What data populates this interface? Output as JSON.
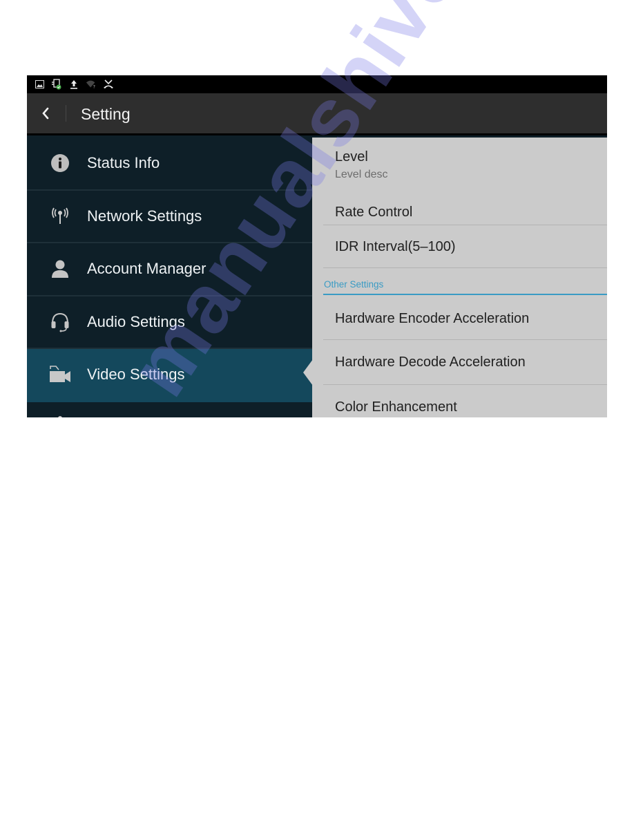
{
  "status_bar": {
    "icons": [
      "image-icon",
      "sim-card-check-icon",
      "upload-icon",
      "wifi-unknown-icon",
      "missed-call-icon"
    ]
  },
  "header": {
    "back_icon": "chevron-left-icon",
    "title": "Setting"
  },
  "sidebar": {
    "selected_index": 4,
    "items": [
      {
        "label": "Status Info",
        "icon": "info-icon"
      },
      {
        "label": "Network Settings",
        "icon": "antenna-icon"
      },
      {
        "label": "Account Manager",
        "icon": "person-icon"
      },
      {
        "label": "Audio Settings",
        "icon": "headset-icon"
      },
      {
        "label": "Video Settings",
        "icon": "video-camera-icon"
      },
      {
        "label": "",
        "icon": "partially-visible-icon"
      }
    ]
  },
  "detail": {
    "rows": [
      {
        "title": "Level",
        "desc": "Level desc"
      },
      {
        "title": "Rate Control"
      },
      {
        "title": "IDR Interval(5–100)"
      }
    ],
    "section": {
      "header": "Other Settings",
      "rows": [
        {
          "title": "Hardware Encoder Acceleration"
        },
        {
          "title": "Hardware Decode Acceleration"
        },
        {
          "title": "Color Enhancement"
        }
      ]
    }
  },
  "colors": {
    "sidebar_bg": "#0e1f28",
    "sidebar_selected": "#14485c",
    "panel_bg": "#cbcbcb",
    "accent": "#3a9bc4",
    "title_bar": "#2e2e2e"
  },
  "watermark": "manualshive.com"
}
